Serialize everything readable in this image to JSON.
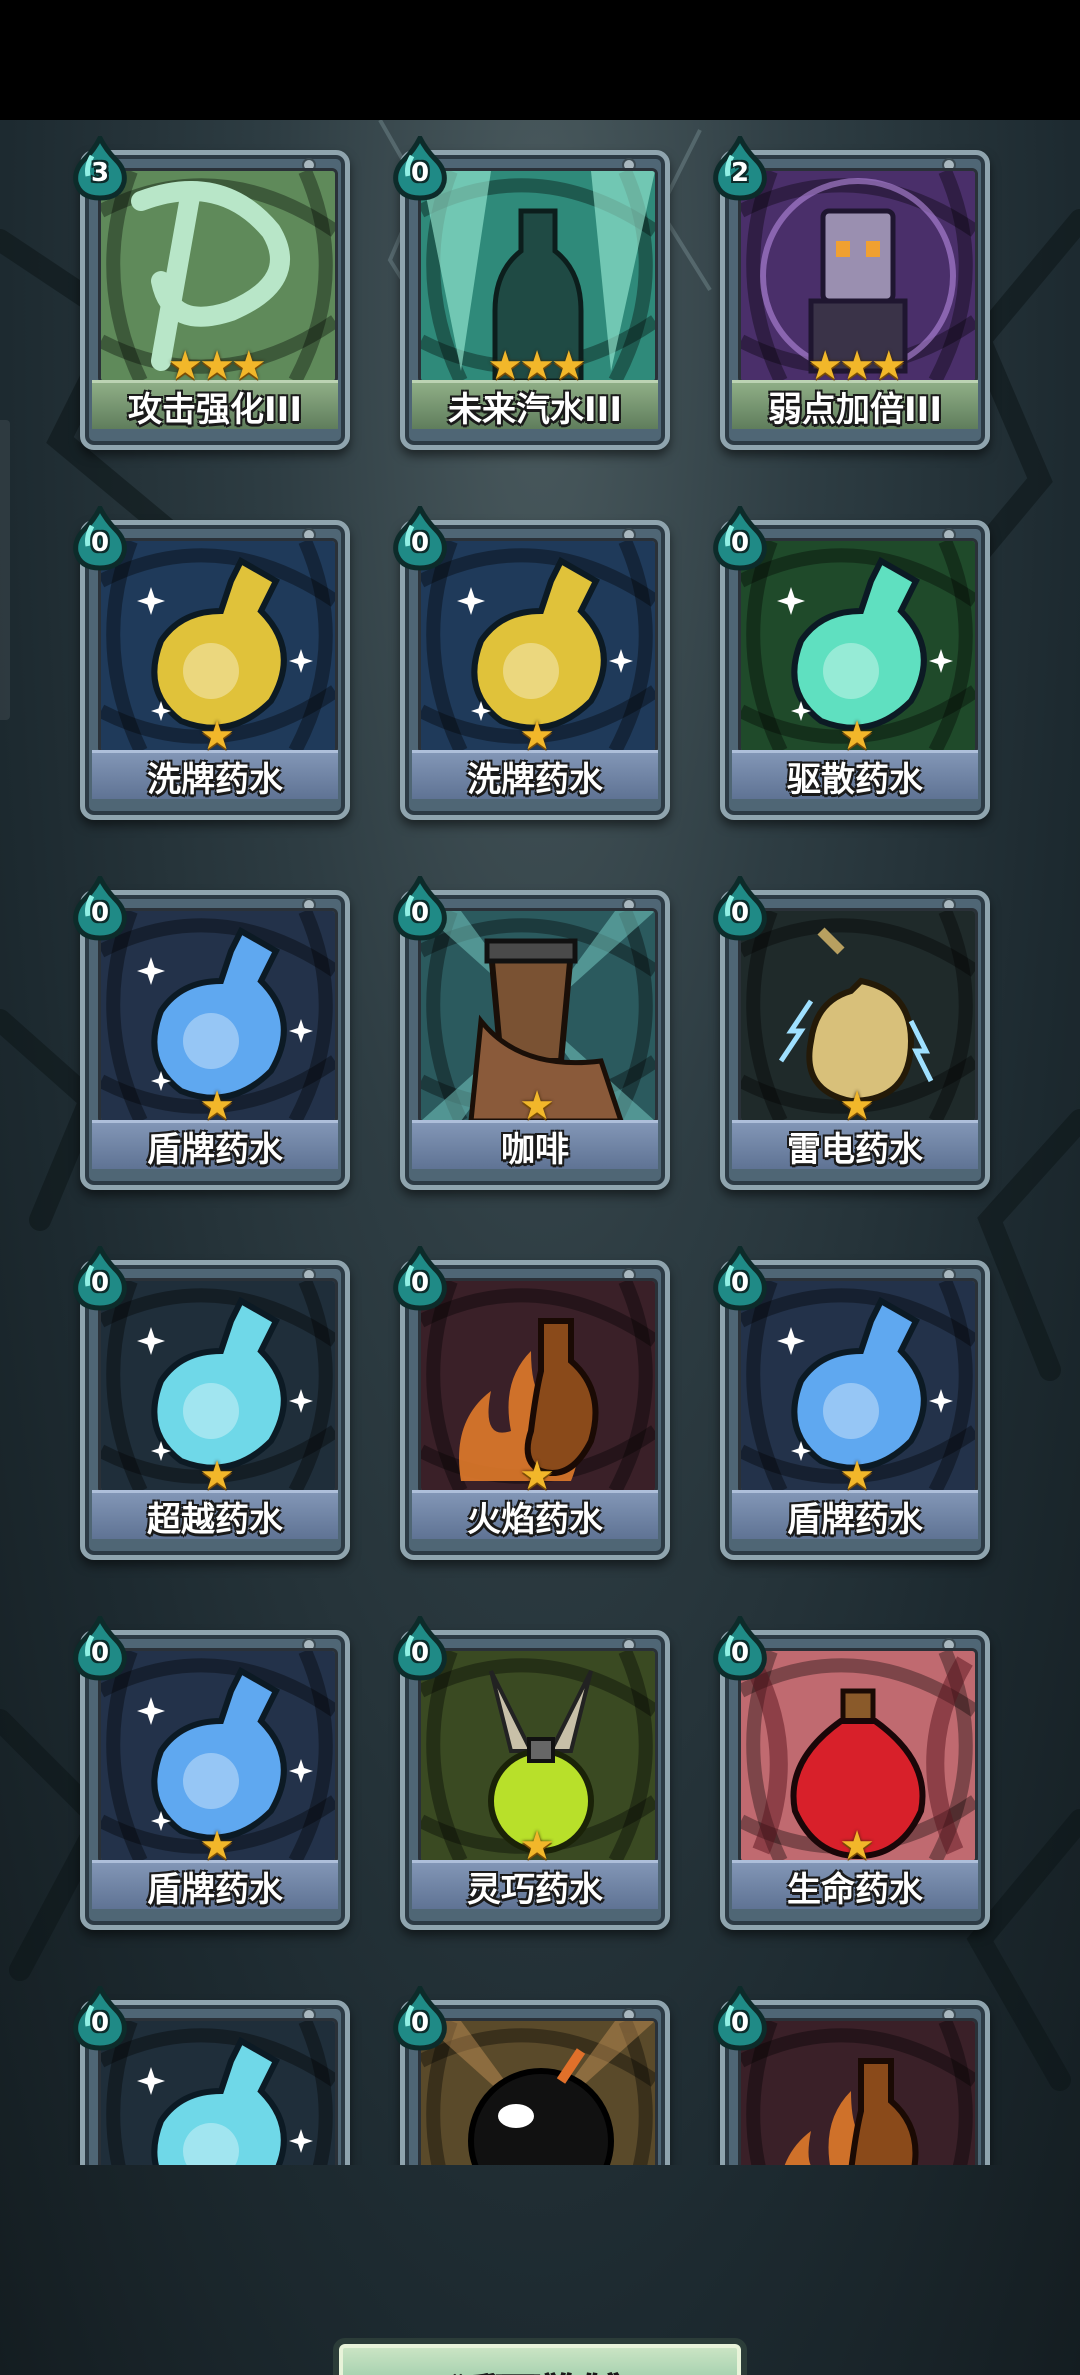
{
  "back_button": {
    "label": "返回旅馆"
  },
  "cards": [
    {
      "name": "攻击强化III",
      "cost": "3",
      "stars": "★★★",
      "upgraded": true,
      "art": "sword-swirl-art",
      "colors": [
        "#5f8a5a",
        "#b8e6c8"
      ]
    },
    {
      "name": "未来汽水III",
      "cost": "0",
      "stars": "★★★",
      "upgraded": true,
      "art": "soda-bottle-art",
      "colors": [
        "#2f8a7a",
        "#9ff0d8"
      ]
    },
    {
      "name": "弱点加倍III",
      "cost": "2",
      "stars": "★★★",
      "upgraded": true,
      "art": "robot-target-art",
      "colors": [
        "#4a2f6a",
        "#b58be0"
      ]
    },
    {
      "name": "洗牌药水",
      "cost": "0",
      "stars": "★",
      "upgraded": false,
      "art": "shuffle-potion-art",
      "colors": [
        "#1f3a5a",
        "#e0c23a"
      ]
    },
    {
      "name": "洗牌药水",
      "cost": "0",
      "stars": "★",
      "upgraded": false,
      "art": "shuffle-potion-art",
      "colors": [
        "#1f3a5a",
        "#e0c23a"
      ]
    },
    {
      "name": "驱散药水",
      "cost": "0",
      "stars": "★",
      "upgraded": false,
      "art": "dispel-potion-art",
      "colors": [
        "#1f4a2a",
        "#5fe0c0"
      ]
    },
    {
      "name": "盾牌药水",
      "cost": "0",
      "stars": "★",
      "upgraded": false,
      "art": "shield-potion-art",
      "colors": [
        "#23324a",
        "#5fa8f0"
      ]
    },
    {
      "name": "咖啡",
      "cost": "0",
      "stars": "★",
      "upgraded": false,
      "art": "coffee-cup-art",
      "colors": [
        "#2b5a5e",
        "#7a5233"
      ]
    },
    {
      "name": "雷电药水",
      "cost": "0",
      "stars": "★",
      "upgraded": false,
      "art": "thunder-potion-art",
      "colors": [
        "#1f2a2a",
        "#d8c07a"
      ]
    },
    {
      "name": "超越药水",
      "cost": "0",
      "stars": "★",
      "upgraded": false,
      "art": "transcend-potion-art",
      "colors": [
        "#1f2e3a",
        "#6fd8e8"
      ]
    },
    {
      "name": "火焰药水",
      "cost": "0",
      "stars": "★",
      "upgraded": false,
      "art": "fire-potion-art",
      "colors": [
        "#3a2028",
        "#e07a2a"
      ]
    },
    {
      "name": "盾牌药水",
      "cost": "0",
      "stars": "★",
      "upgraded": false,
      "art": "shield-potion-art",
      "colors": [
        "#23324a",
        "#5fa8f0"
      ]
    },
    {
      "name": "盾牌药水",
      "cost": "0",
      "stars": "★",
      "upgraded": false,
      "art": "shield-potion-art",
      "colors": [
        "#23324a",
        "#5fa8f0"
      ]
    },
    {
      "name": "灵巧药水",
      "cost": "0",
      "stars": "★",
      "upgraded": false,
      "art": "agility-potion-art",
      "colors": [
        "#3a4a22",
        "#b8e02a"
      ]
    },
    {
      "name": "生命药水",
      "cost": "0",
      "stars": "★",
      "upgraded": false,
      "art": "life-potion-art",
      "colors": [
        "#c06a70",
        "#d8202a"
      ]
    },
    {
      "name": "",
      "cost": "0",
      "stars": "",
      "upgraded": false,
      "art": "transcend-potion-art",
      "colors": [
        "#1f2e3a",
        "#6fd8e8"
      ]
    },
    {
      "name": "",
      "cost": "0",
      "stars": "",
      "upgraded": false,
      "art": "bomb-art",
      "colors": [
        "#5a4a2a",
        "#111111"
      ]
    },
    {
      "name": "",
      "cost": "0",
      "stars": "",
      "upgraded": false,
      "art": "fire-potion-art",
      "colors": [
        "#3a2028",
        "#e07a2a"
      ]
    }
  ]
}
